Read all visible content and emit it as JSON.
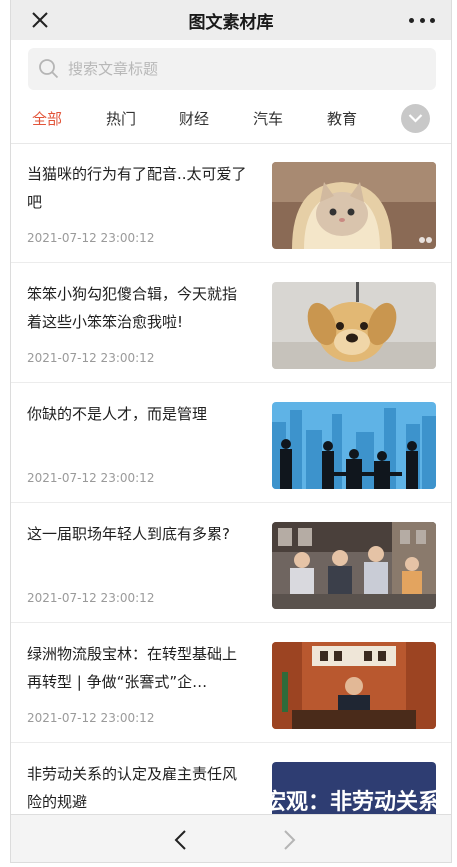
{
  "header": {
    "title": "图文素材库",
    "close_icon": "close-icon",
    "more_icon": "more-dots-icon"
  },
  "search": {
    "placeholder": "搜索文章标题",
    "value": "",
    "icon": "search-icon"
  },
  "tabs": [
    {
      "label": "全部",
      "active": true
    },
    {
      "label": "热门",
      "active": false
    },
    {
      "label": "财经",
      "active": false
    },
    {
      "label": "汽车",
      "active": false
    },
    {
      "label": "教育",
      "active": false
    }
  ],
  "tabs_more_icon": "chevron-down-icon",
  "articles": [
    {
      "title": "当猫咪的行为有了配音..太可爱了吧",
      "date": "2021-07-12 23:00:12",
      "thumb": "cat-in-bread-image"
    },
    {
      "title": "笨笨小狗勾犯傻合辑，今天就指着这些小笨笨治愈我啦!",
      "date": "2021-07-12 23:00:12",
      "thumb": "puppy-image"
    },
    {
      "title": "你缺的不是人才，而是管理",
      "date": "2021-07-12 23:00:12",
      "thumb": "city-silhouette-image"
    },
    {
      "title": "这一届职场年轻人到底有多累?",
      "date": "2021-07-12 23:00:12",
      "thumb": "office-meeting-image"
    },
    {
      "title": "绿洲物流殷宝林：在转型基础上再转型 | 争做“张謇式”企…",
      "date": "2021-07-12 23:00:12",
      "thumb": "executive-desk-image"
    },
    {
      "title": "非劳动关系的认定及雇主责任风险的规避",
      "date": "",
      "thumb": "banner-image",
      "thumb_text": "宏观：非劳动关系"
    }
  ],
  "bottom_nav": {
    "back_icon": "chevron-left-icon",
    "forward_icon": "chevron-right-icon"
  },
  "colors": {
    "accent": "#e2553a",
    "header_bg": "#ededed",
    "search_bg": "#f2f2f2",
    "date": "#9a9a9a"
  }
}
